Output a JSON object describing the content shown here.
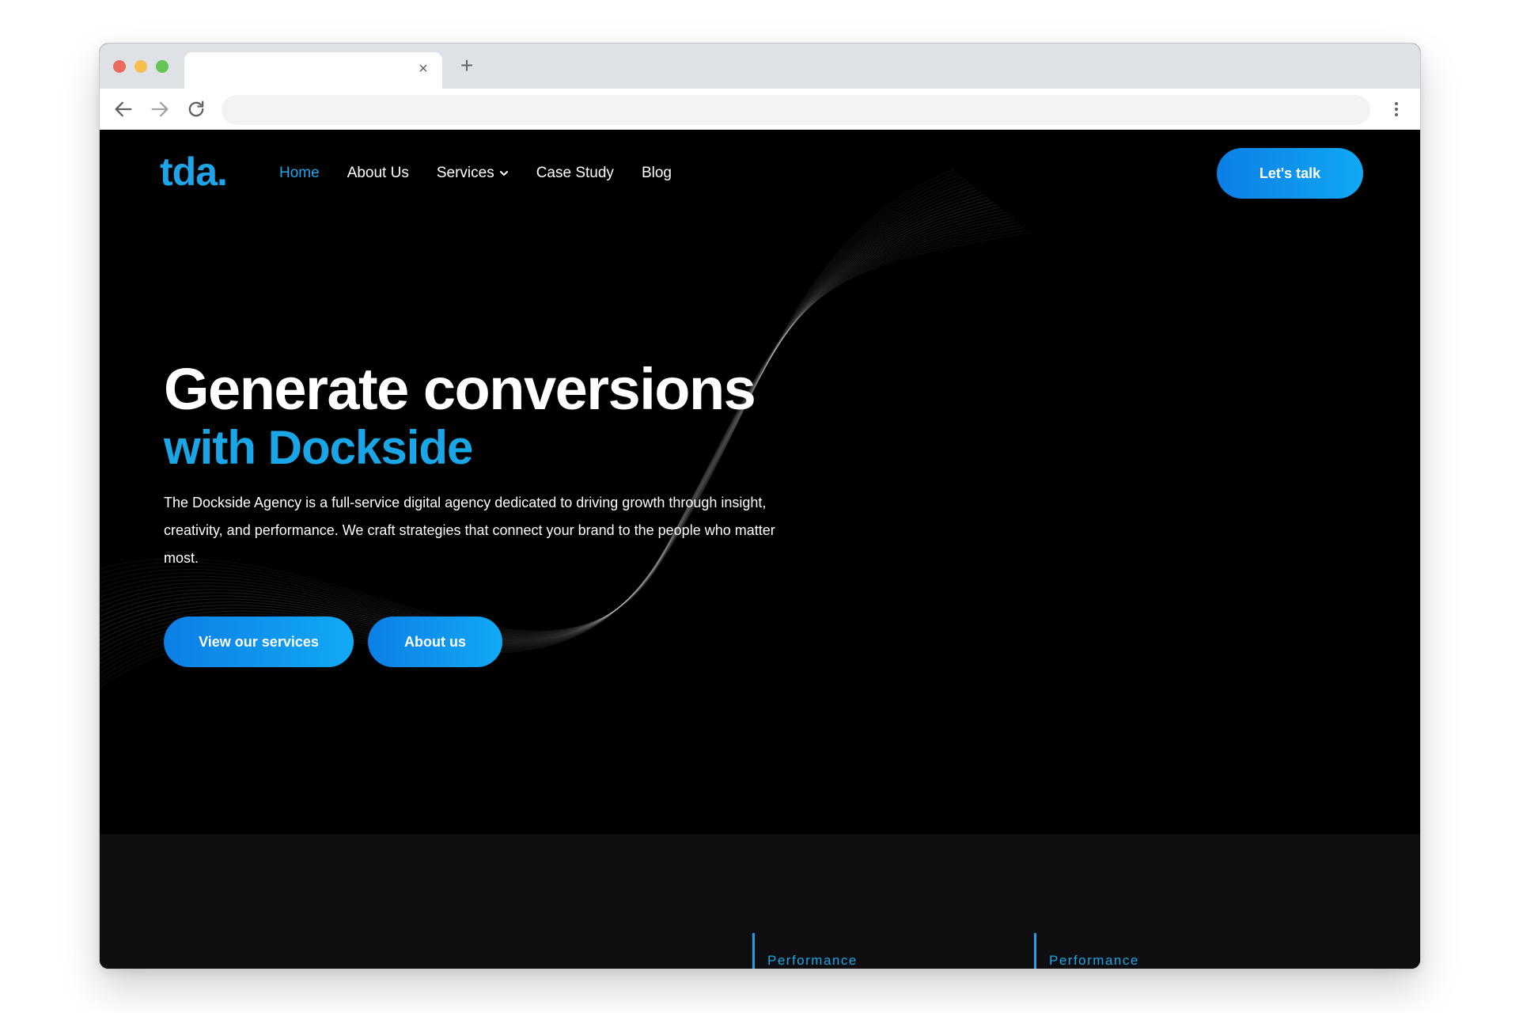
{
  "browser": {
    "tab_title": "",
    "tab_close_glyph": "×",
    "new_tab_glyph": "+",
    "address_value": "",
    "icons": [
      "back-arrow-icon",
      "forward-arrow-icon",
      "reload-icon",
      "menu-dots-icon"
    ]
  },
  "site": {
    "logo": "tda.",
    "nav": {
      "home": "Home",
      "about": "About Us",
      "services": "Services",
      "case_study": "Case Study",
      "blog": "Blog"
    },
    "cta": "Let's talk"
  },
  "hero": {
    "title": "Generate conversions",
    "title_accent": "with Dockside",
    "description": "The Dockside Agency is a full-service digital agency dedicated to driving growth through insight, creativity, and performance. We craft strategies that connect your brand to the people who matter most.",
    "primary_button": "View our services",
    "secondary_button": "About us"
  },
  "stats": [
    {
      "label": "Performance"
    },
    {
      "label": "Performance"
    }
  ],
  "colors": {
    "accent": "#1ea4e8",
    "button_gradient_start": "#0b7fe6",
    "button_gradient_end": "#11a8f4",
    "background": "#000000",
    "lower_section": "#0e0e10"
  }
}
